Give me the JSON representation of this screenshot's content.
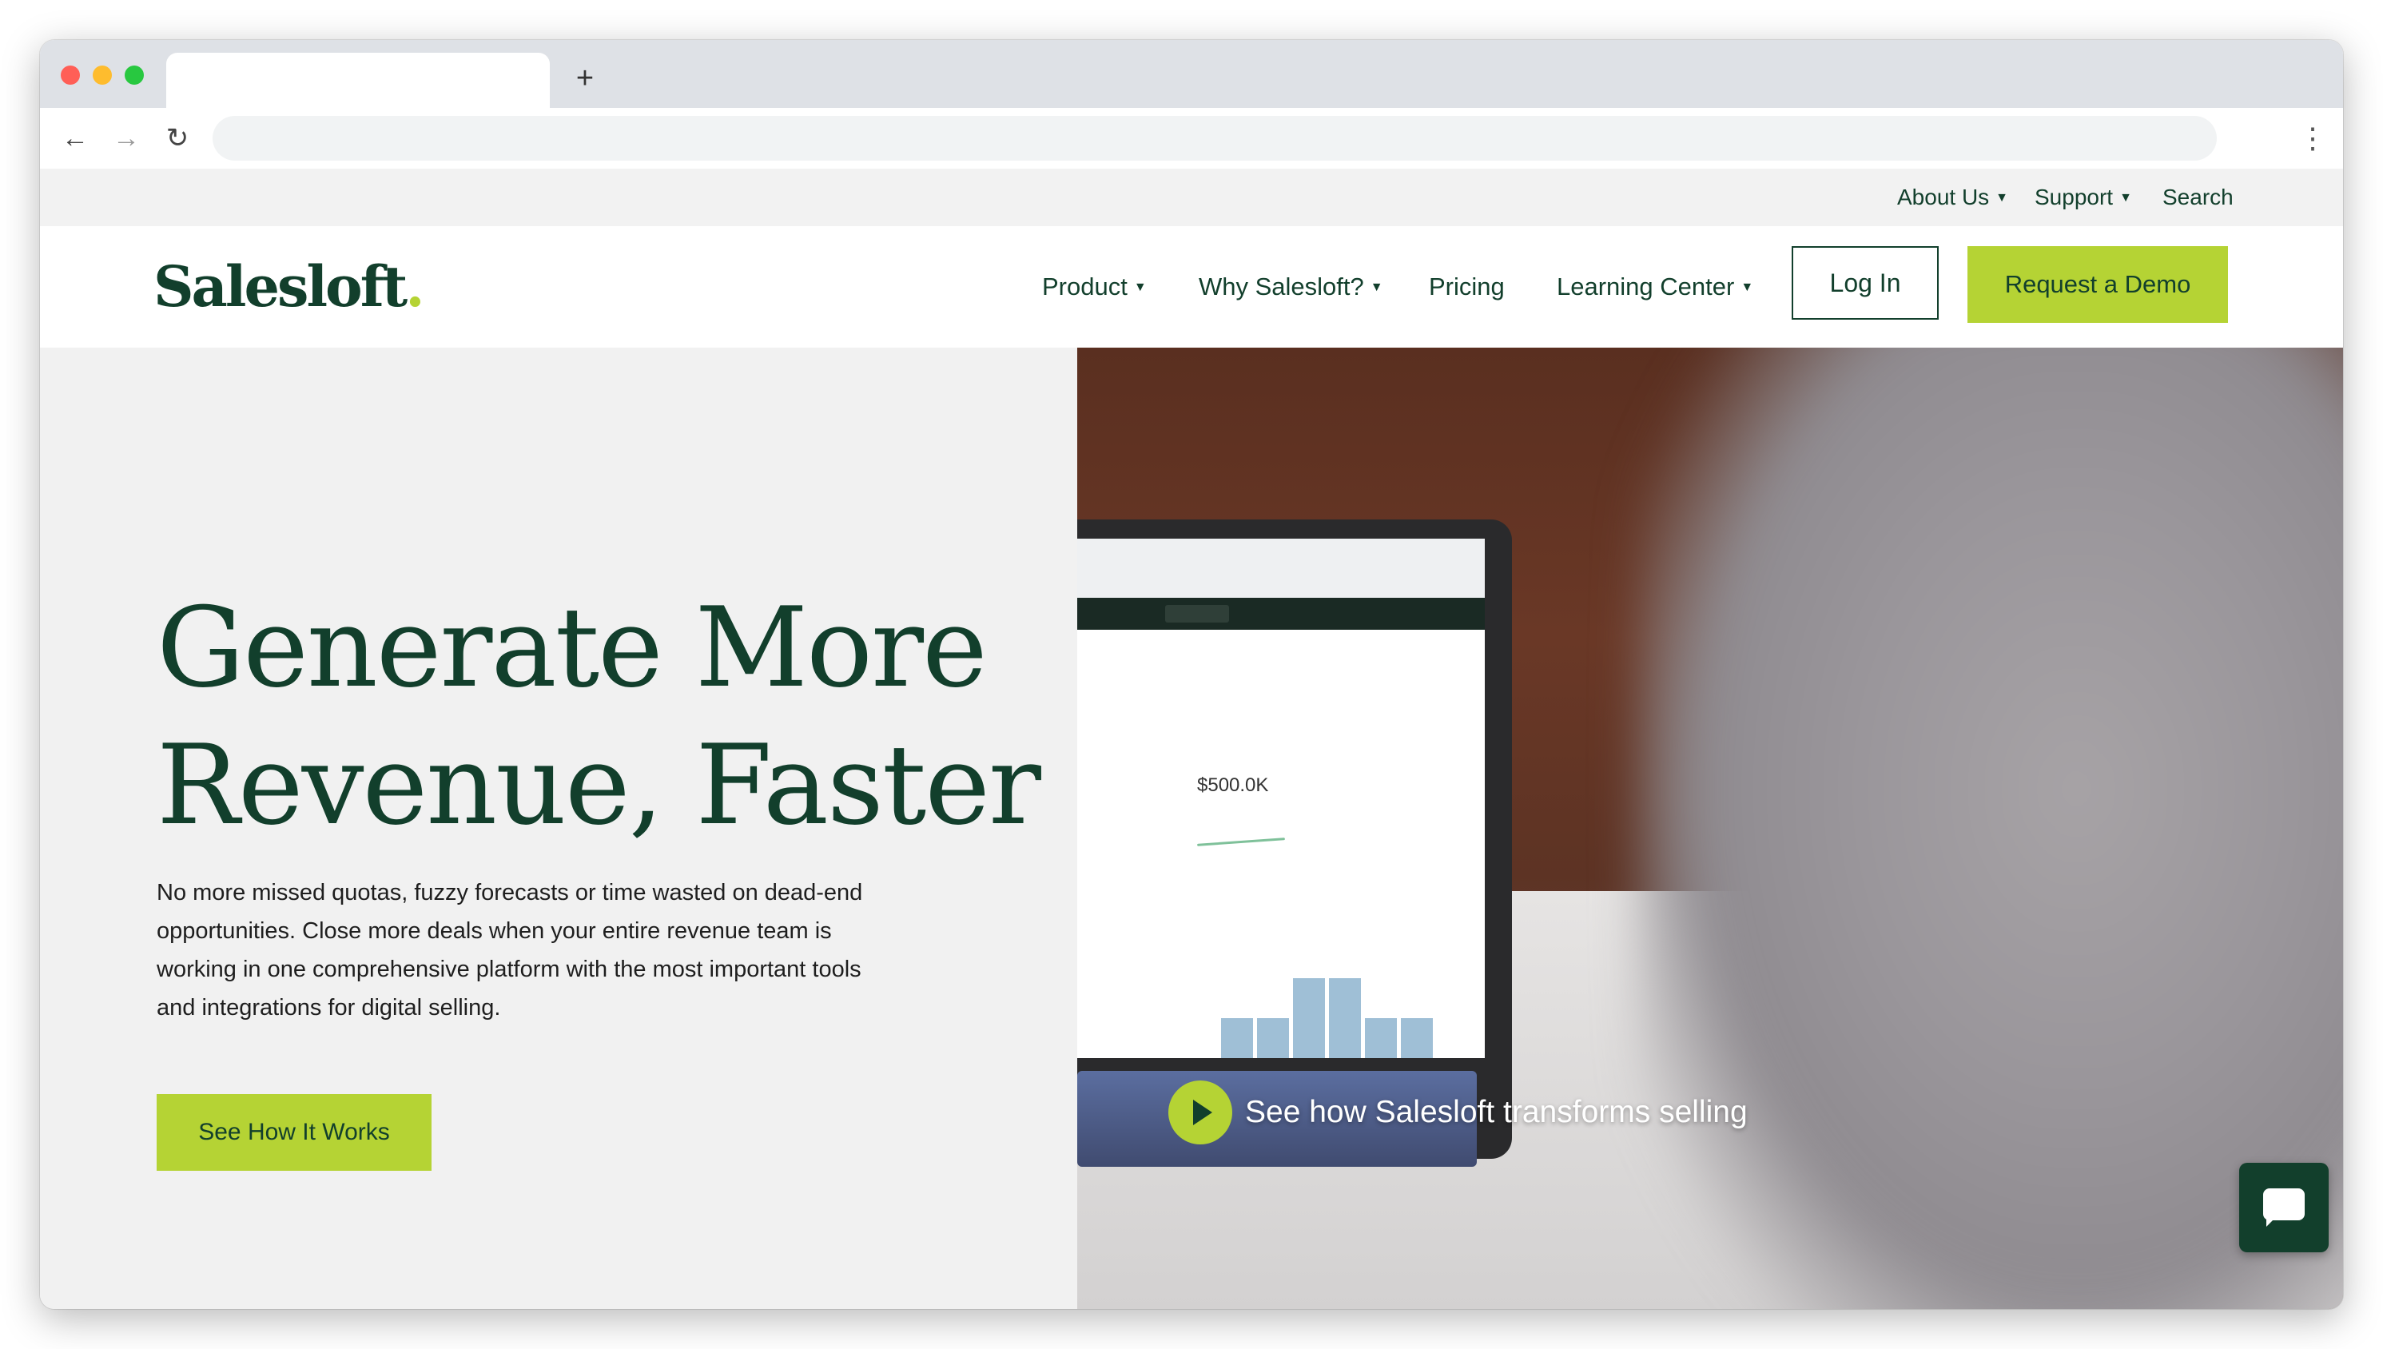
{
  "browser": {
    "new_tab_label": "+",
    "back_icon": "arrow-left-icon",
    "forward_icon": "arrow-right-icon",
    "reload_icon": "reload-icon",
    "menu_icon": "kebab-menu-icon"
  },
  "utility_nav": {
    "about": "About Us",
    "support": "Support",
    "search": "Search"
  },
  "main_nav": {
    "logo_text": "Salesloft",
    "logo_dot": ".",
    "product": "Product",
    "why": "Why Salesloft?",
    "pricing": "Pricing",
    "learning": "Learning Center",
    "login": "Log In",
    "demo": "Request a Demo"
  },
  "hero": {
    "headline_line1": "Generate More",
    "headline_line2": "Revenue, Faster",
    "subtext": "No more missed quotas, fuzzy forecasts or time wasted on dead-end opportunities. Close more deals when your entire revenue team is working in one comprehensive platform with the most important tools and integrations for digital selling.",
    "cta": "See How It Works",
    "video_label": "See how Salesloft transforms selling",
    "screen_stat": "$500.0K"
  },
  "colors": {
    "brand_green": "#123f2c",
    "accent_lime": "#b5d334",
    "hero_bg": "#f1f1f1"
  }
}
